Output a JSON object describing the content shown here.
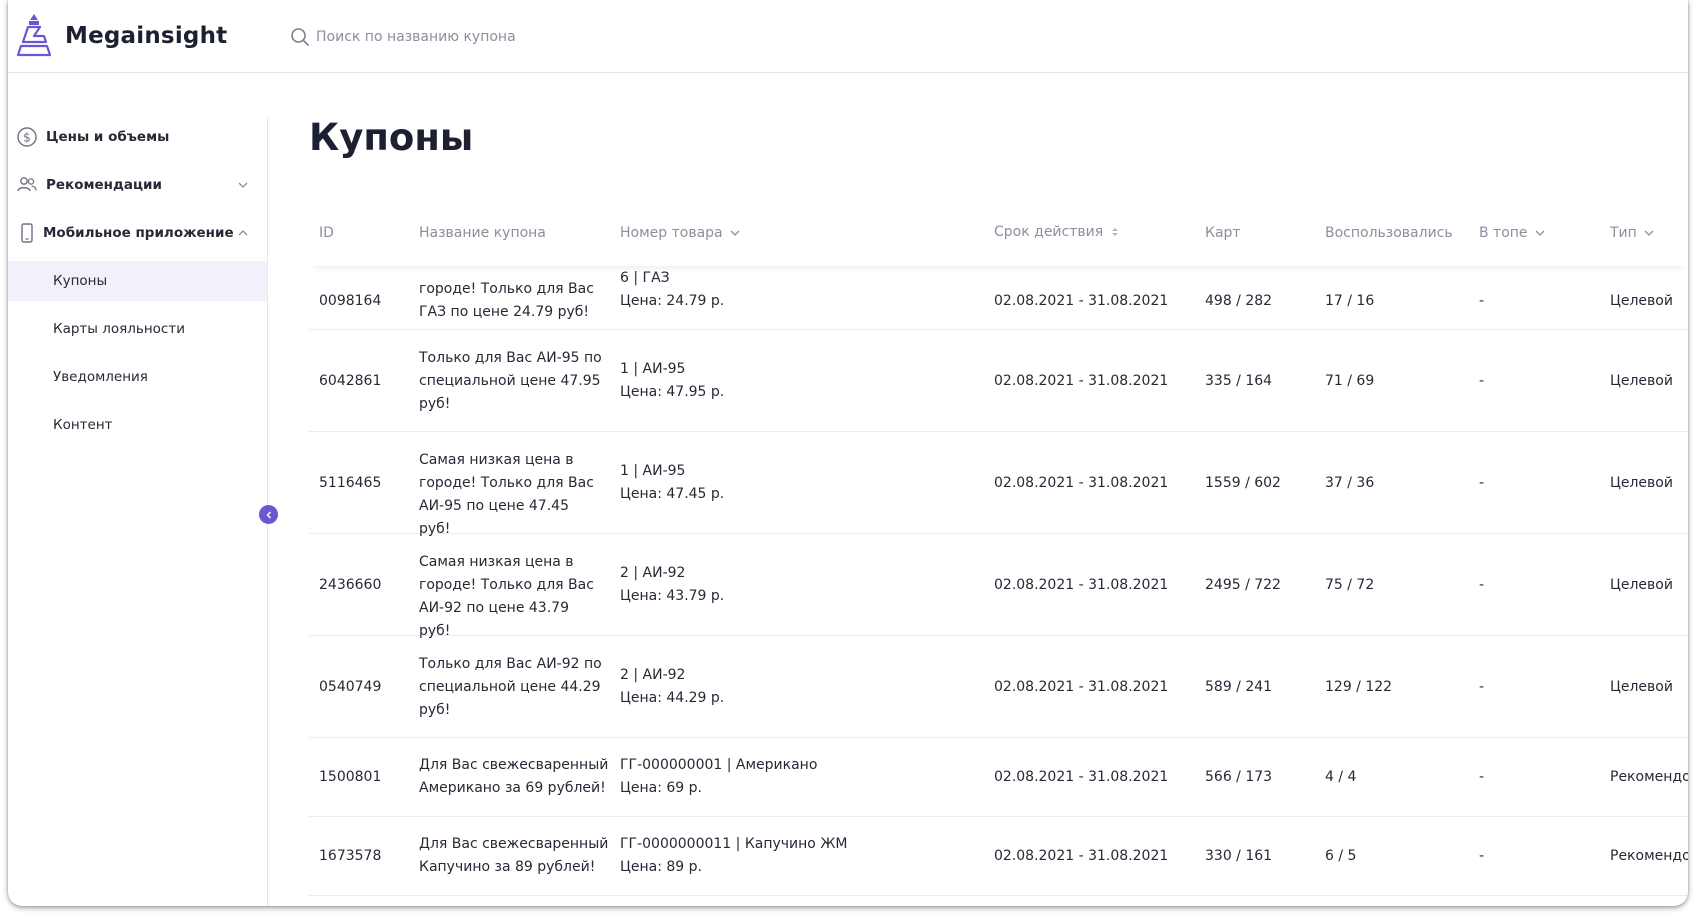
{
  "app": {
    "brand": "Megainsight",
    "search_placeholder": "Поиск по названию купона"
  },
  "sidebar": {
    "items": [
      {
        "label": "Цены и объемы",
        "icon": "dollar-circle-icon"
      },
      {
        "label": "Рекомендации",
        "icon": "users-icon",
        "chevron": "chevron-down-icon"
      },
      {
        "label": "Мобильное приложение",
        "icon": "phone-icon",
        "chevron": "chevron-up-icon"
      }
    ],
    "subitems": [
      {
        "label": "Купоны",
        "active": true
      },
      {
        "label": "Карты лояльности"
      },
      {
        "label": "Уведомления"
      },
      {
        "label": "Контент"
      }
    ]
  },
  "page": {
    "title": "Купоны"
  },
  "table": {
    "headers": {
      "id": "ID",
      "name": "Название купона",
      "product": "Номер товара",
      "period": "Срок действия",
      "cards": "Карт",
      "used": "Воспользовались",
      "top": "В топе",
      "type": "Тип"
    },
    "rows": [
      {
        "id": "0098164",
        "name_lines": [
          "городе! Только для Вас",
          "ГАЗ по цене 24.79 руб!"
        ],
        "product_lines": [
          "6 | ГАЗ",
          "Цена: 24.79 р."
        ],
        "period": "02.08.2021 - 31.08.2021",
        "cards": "498 / 282",
        "used": "17 / 16",
        "top": "-",
        "type": "Целевой"
      },
      {
        "id": "6042861",
        "name_lines": [
          "Только для Вас АИ-95 по",
          "специальной цене 47.95",
          "руб!"
        ],
        "product_lines": [
          "1 | АИ-95",
          "Цена: 47.95 р."
        ],
        "period": "02.08.2021 - 31.08.2021",
        "cards": "335 / 164",
        "used": "71 / 69",
        "top": "-",
        "type": "Целевой"
      },
      {
        "id": "5116465",
        "name_lines": [
          "Самая низкая цена в",
          "городе! Только для Вас",
          "АИ-95 по цене 47.45 руб!"
        ],
        "product_lines": [
          "1 | АИ-95",
          "Цена: 47.45 р."
        ],
        "period": "02.08.2021 - 31.08.2021",
        "cards": "1559 / 602",
        "used": "37 / 36",
        "top": "-",
        "type": "Целевой"
      },
      {
        "id": "2436660",
        "name_lines": [
          "Самая низкая цена в",
          "городе! Только для Вас",
          "АИ-92 по цене 43.79 руб!"
        ],
        "product_lines": [
          "2 | АИ-92",
          "Цена: 43.79 р."
        ],
        "period": "02.08.2021 - 31.08.2021",
        "cards": "2495 / 722",
        "used": "75 / 72",
        "top": "-",
        "type": "Целевой"
      },
      {
        "id": "0540749",
        "name_lines": [
          "Только для Вас АИ-92 по",
          "специальной цене 44.29",
          "руб!"
        ],
        "product_lines": [
          "2 | АИ-92",
          "Цена: 44.29 р."
        ],
        "period": "02.08.2021 - 31.08.2021",
        "cards": "589 / 241",
        "used": "129 / 122",
        "top": "-",
        "type": "Целевой"
      },
      {
        "id": "1500801",
        "name_lines": [
          "Для Вас свежесваренный",
          "Американо за 69 рублей!"
        ],
        "product_lines": [
          "ГГ-000000001 | Американо",
          "Цена: 69 р."
        ],
        "period": "02.08.2021 - 31.08.2021",
        "cards": "566 / 173",
        "used": "4 / 4",
        "top": "-",
        "type": "Рекомендова"
      },
      {
        "id": "1673578",
        "name_lines": [
          "Для Вас свежесваренный",
          "Капучино за 89 рублей!"
        ],
        "product_lines": [
          "ГГ-0000000011 | Капучино ЖМ",
          "Цена: 89 р."
        ],
        "period": "02.08.2021 - 31.08.2021",
        "cards": "330 / 161",
        "used": "6 / 5",
        "top": "-",
        "type": "Рекомендова"
      }
    ]
  },
  "colors": {
    "accent": "#6b57d2",
    "active_bg": "#f2f1fb",
    "muted_text": "#8b8f9e",
    "text": "#262a36"
  }
}
